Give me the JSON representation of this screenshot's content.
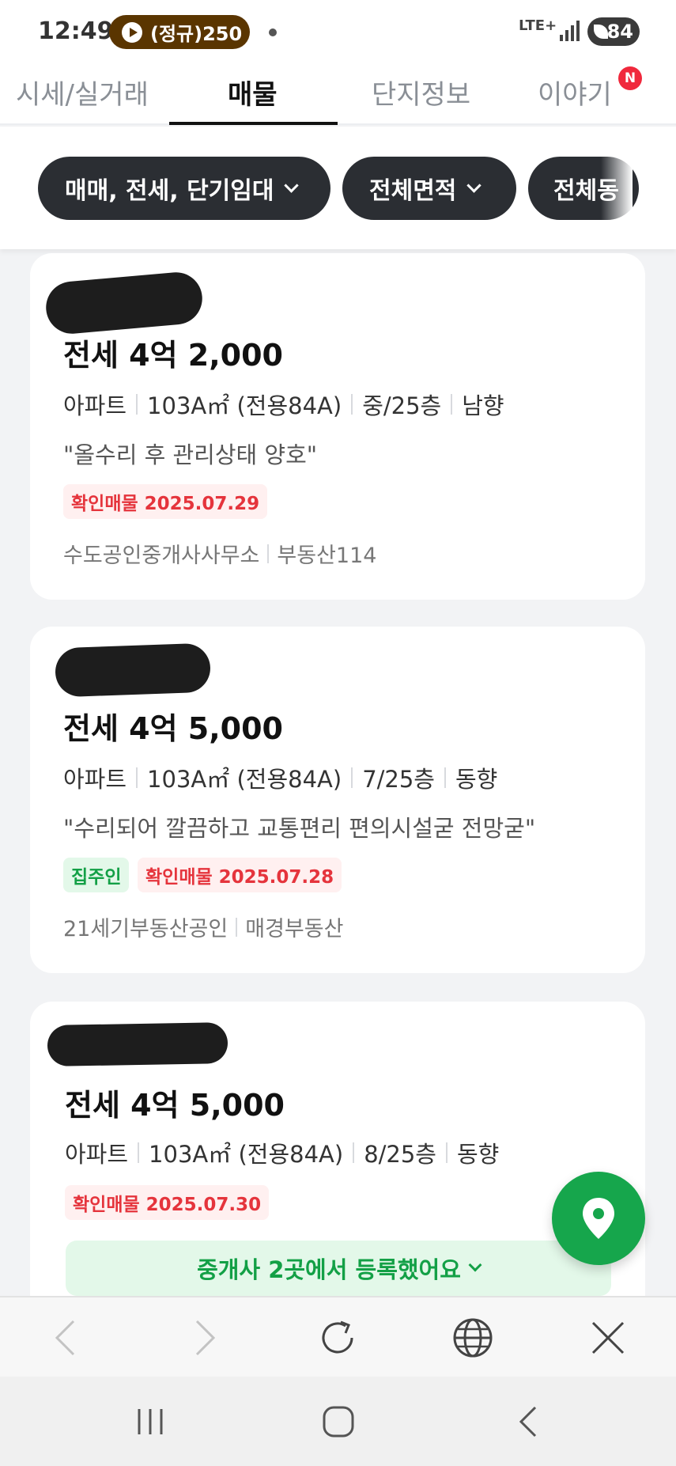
{
  "status_bar": {
    "time": "12:49",
    "media_label": "(정규)250",
    "network": "LTE+",
    "battery": "84"
  },
  "tabs": [
    {
      "label": "시세/실거래",
      "active": false
    },
    {
      "label": "매물",
      "active": true
    },
    {
      "label": "단지정보",
      "active": false
    },
    {
      "label": "이야기",
      "active": false,
      "badge": "N"
    }
  ],
  "filters": [
    {
      "label": "매매, 전세, 단기임대"
    },
    {
      "label": "전체면적"
    },
    {
      "label": "전체동"
    }
  ],
  "listings": [
    {
      "price": "전세 4억 2,000",
      "specs": [
        "아파트",
        "103A㎡ (전용84A)",
        "중/25층",
        "남향"
      ],
      "description": "\"올수리 후 관리상태 양호\"",
      "tags": [
        {
          "text": "확인매물 2025.07.29",
          "color": "red"
        }
      ],
      "agency": [
        "수도공인중개사사무소",
        "부동산114"
      ]
    },
    {
      "price": "전세 4억 5,000",
      "specs": [
        "아파트",
        "103A㎡ (전용84A)",
        "7/25층",
        "동향"
      ],
      "description": "\"수리되어 깔끔하고 교통편리 편의시설굳 전망굳\"",
      "tags": [
        {
          "text": "집주인",
          "color": "green"
        },
        {
          "text": "확인매물 2025.07.28",
          "color": "red"
        }
      ],
      "agency": [
        "21세기부동산공인",
        "매경부동산"
      ]
    },
    {
      "price": "전세 4억 5,000",
      "specs": [
        "아파트",
        "103A㎡ (전용84A)",
        "8/25층",
        "동향"
      ],
      "tags": [
        {
          "text": "확인매물 2025.07.30",
          "color": "red"
        }
      ],
      "registration_banner": "중개사 2곳에서 등록했어요"
    }
  ],
  "colors": {
    "accent_green": "#16a64c",
    "tag_red": "#e5343c",
    "chip_dark": "#2b2e33",
    "badge_red": "#f0283c"
  },
  "icons": {
    "fab": "map-pin-icon",
    "browser": [
      "back-arrow-icon",
      "forward-arrow-icon",
      "refresh-icon",
      "globe-icon",
      "close-icon"
    ],
    "system": [
      "recent-apps-icon",
      "home-icon",
      "back-icon"
    ]
  }
}
